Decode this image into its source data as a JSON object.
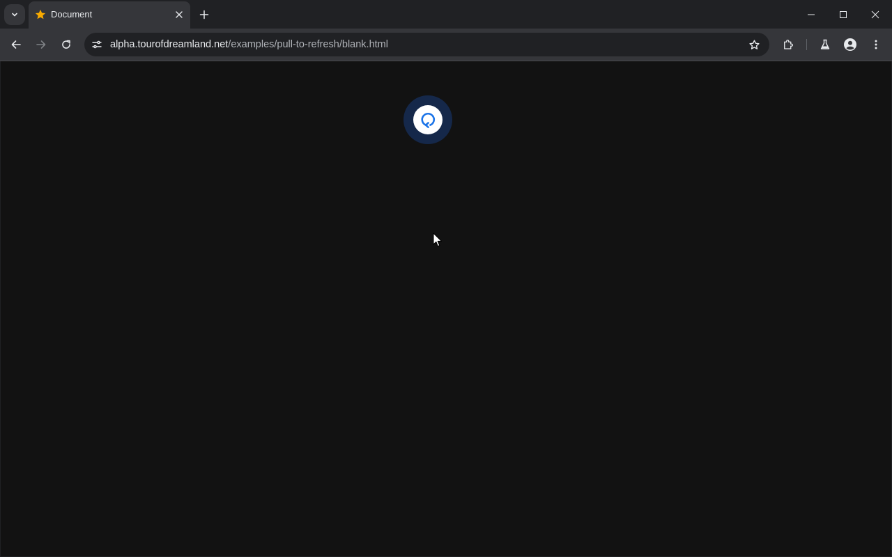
{
  "tab": {
    "title": "Document",
    "favicon": "star-icon"
  },
  "address_bar": {
    "host": "alpha.tourofdreamland.net",
    "path": "/examples/pull-to-refresh/blank.html"
  },
  "icons": {
    "tab_search": "chevron-down-icon",
    "tab_close": "close-icon",
    "new_tab": "plus-icon",
    "minimize": "minimize-icon",
    "maximize": "maximize-icon",
    "close_window": "close-icon",
    "back": "arrow-left-icon",
    "forward": "arrow-right-icon",
    "reload": "reload-icon",
    "site_info": "tune-icon",
    "bookmark": "star-outline-icon",
    "extensions": "puzzle-icon",
    "labs": "flask-icon",
    "profile": "account-icon",
    "menu": "kebab-menu-icon",
    "pull_to_refresh": "refresh-icon"
  },
  "colors": {
    "frame": "#202124",
    "toolbar": "#35363a",
    "page_background": "#121212",
    "refresh_accent": "#1a73e8",
    "favicon": "#f9ab00"
  }
}
